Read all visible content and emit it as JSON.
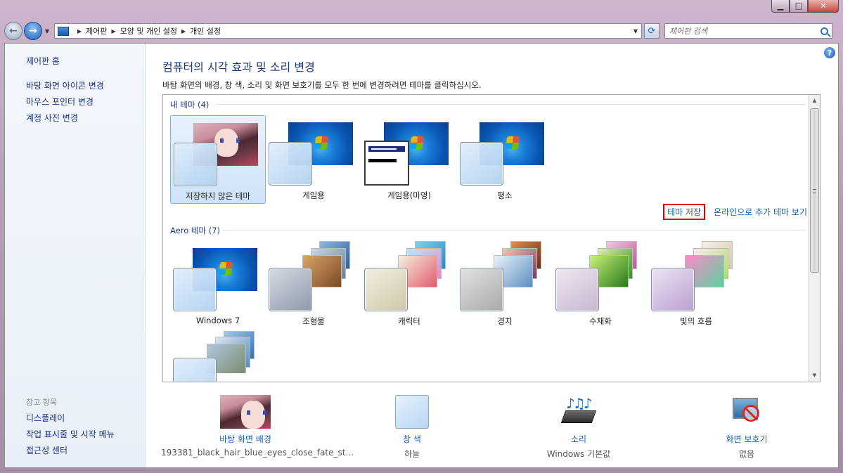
{
  "address": {
    "crumbs": [
      "제어판",
      "모양 및 개인 설정",
      "개인 설정"
    ],
    "search_placeholder": "제어판 검색"
  },
  "sidebar": {
    "home": "제어판 홈",
    "links": [
      "바탕 화면 아이콘 변경",
      "마우스 포인터 변경",
      "계정 사진 변경"
    ],
    "see_also_title": "참고 항목",
    "see_also": [
      "디스플레이",
      "작업 표시줄 및 시작 메뉴",
      "접근성 센터"
    ]
  },
  "main": {
    "title": "컴퓨터의 시각 효과 및 소리 변경",
    "description": "바탕 화면의 배경, 창 색, 소리 및 화면 보호기를 모두 한 번에 변경하려면 테마를 클릭하십시오.",
    "my_themes_header": "내 테마 (4)",
    "my_themes": [
      "저장하지 않은 테마",
      "게임용",
      "게임용(마영)",
      "평소"
    ],
    "save_theme": "테마 저장",
    "get_more_online": "온라인으로 추가 테마 보기",
    "aero_header": "Aero 테마 (7)",
    "aero_themes": [
      "Windows 7",
      "조형물",
      "캐릭터",
      "경치",
      "수채화",
      "빛의 흐름"
    ]
  },
  "summary": {
    "background_title": "바탕 화면 배경",
    "background_value": "193381_black_hair_blue_eyes_close_fate_st...",
    "color_title": "창 색",
    "color_value": "하늘",
    "sound_title": "소리",
    "sound_value": "Windows 기본값",
    "saver_title": "화면 보호기",
    "saver_value": "없음"
  }
}
